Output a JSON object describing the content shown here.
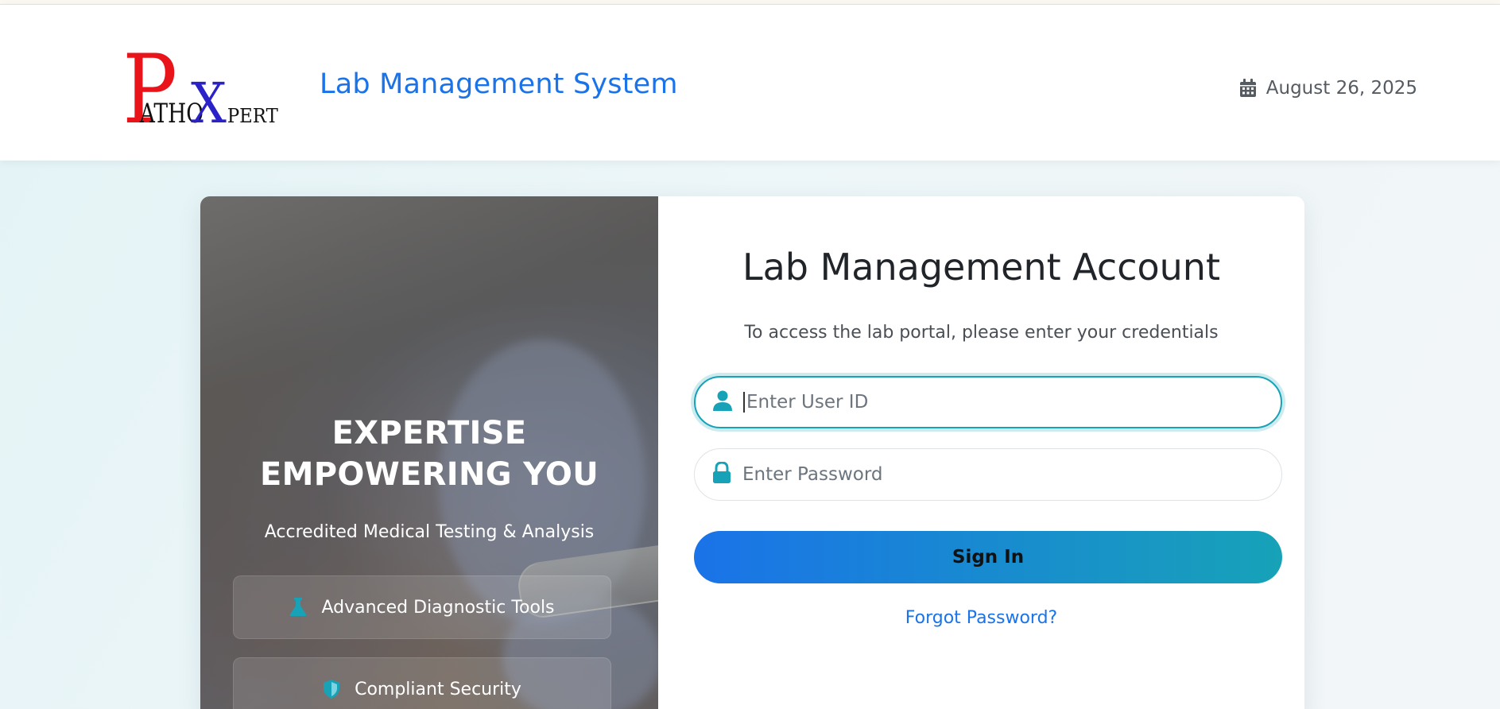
{
  "header": {
    "logo": {
      "big_p": "P",
      "small_atho": "ATHO",
      "big_x": "X",
      "small_pert": "PERT"
    },
    "app_title": "Lab Management System",
    "date": "August 26, 2025"
  },
  "hero": {
    "title_line1": "EXPERTISE",
    "title_line2": "EMPOWERING YOU",
    "subtitle": "Accredited Medical Testing & Analysis",
    "features": [
      {
        "label": "Advanced Diagnostic Tools",
        "icon": "flask-icon"
      },
      {
        "label": "Compliant Security",
        "icon": "shield-icon"
      }
    ]
  },
  "form": {
    "title": "Lab Management Account",
    "subtitle": "To access the lab portal, please enter your credentials",
    "user_placeholder": "Enter User ID",
    "password_placeholder": "Enter Password",
    "signin_label": "Sign In",
    "forgot_label": "Forgot Password?"
  },
  "colors": {
    "primary": "#1a73e8",
    "accent": "#17a2b8",
    "logo_red": "#e8141a",
    "logo_blue": "#2a22c8"
  }
}
